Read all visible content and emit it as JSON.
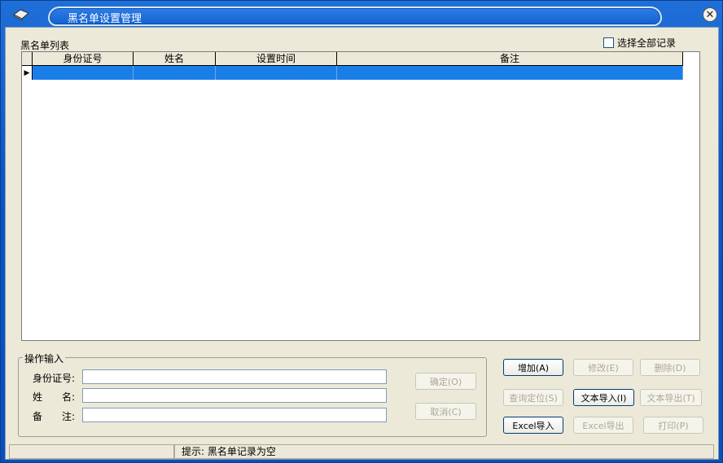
{
  "window": {
    "title": "黑名单设置管理",
    "close_label": "✕"
  },
  "list": {
    "label": "黑名单列表",
    "select_all_label": "选择全部记录",
    "columns": [
      "身份证号",
      "姓名",
      "设置时间",
      "备注"
    ],
    "row_indicator": "▶"
  },
  "form": {
    "group_label": "操作输入",
    "id_label": "身份证号:",
    "name_label": "姓　　名:",
    "note_label": "备　　注:",
    "id_value": "",
    "name_value": "",
    "note_value": ""
  },
  "buttons": {
    "confirm": "确定(O)",
    "cancel": "取消(C)",
    "add": "增加(A)",
    "modify": "修改(E)",
    "delete": "删除(D)",
    "query": "查询定位(S)",
    "text_import": "文本导入(I)",
    "text_export": "文本导出(T)",
    "excel_import": "Excel导入",
    "excel_export": "Excel导出",
    "print": "打印(P)"
  },
  "status": {
    "hint": "提示: 黑名单记录为空"
  },
  "colors": {
    "title_bar": "#0c55c4",
    "selection": "#1a7ee8",
    "face": "#ece9d8"
  }
}
